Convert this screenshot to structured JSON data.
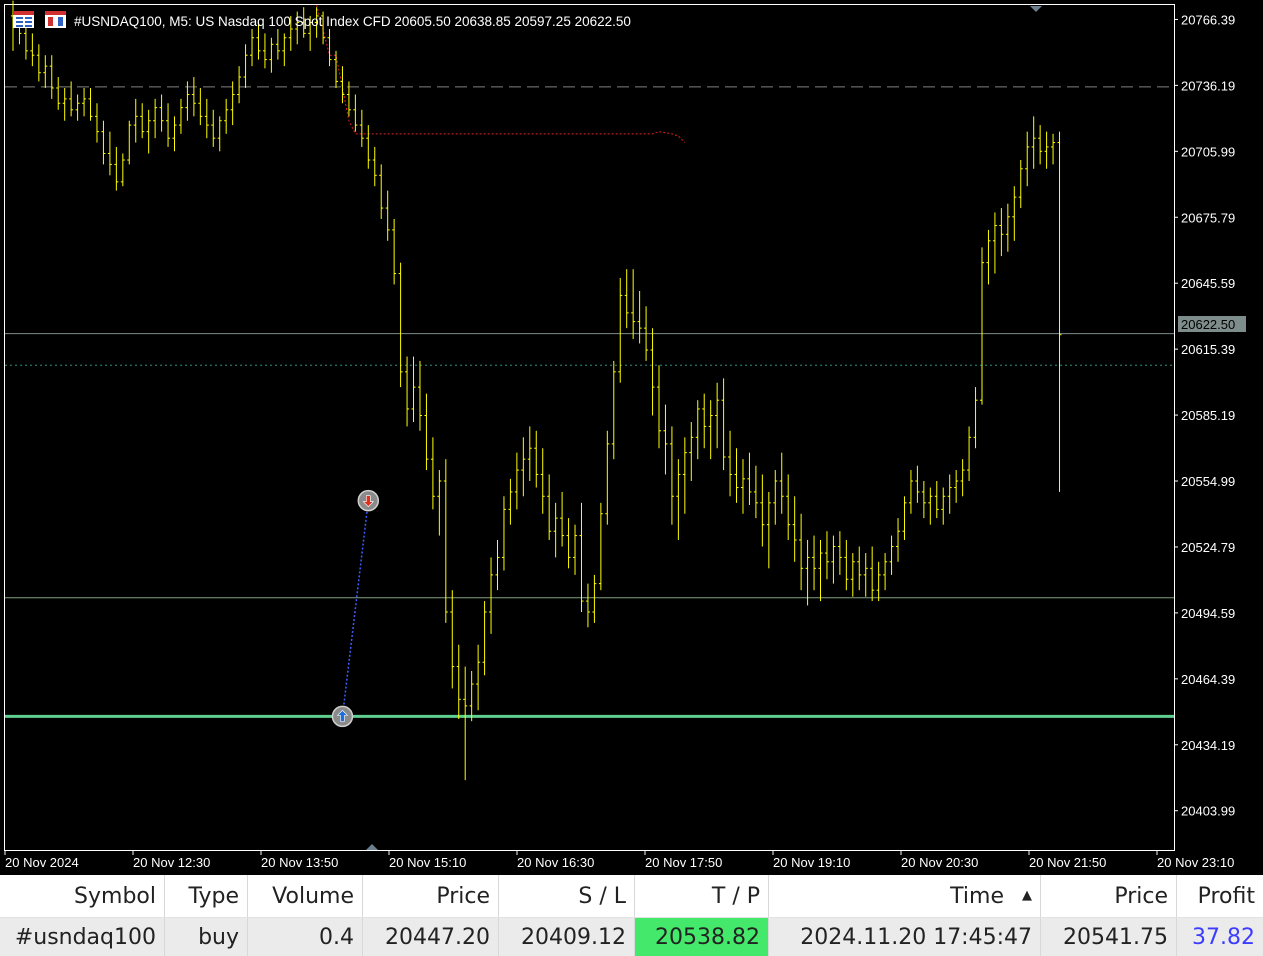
{
  "header": {
    "title": "#USNDAQ100, M5:  US Nasdaq 100 Spot Index CFD  20605.50 20638.85 20597.25 20622.50",
    "icons": [
      "chart-menu-icon",
      "one-click-trading-icon"
    ]
  },
  "price_axis": {
    "labels": [
      "20766.39",
      "20736.19",
      "20705.99",
      "20675.79",
      "20645.59",
      "20615.39",
      "20585.19",
      "20554.99",
      "20524.79",
      "20494.59",
      "20464.39",
      "20434.19",
      "20403.99"
    ],
    "current_price_label": "20622.50"
  },
  "time_axis": {
    "labels": [
      "20 Nov 2024",
      "20 Nov 12:30",
      "20 Nov 13:50",
      "20 Nov 15:10",
      "20 Nov 16:30",
      "20 Nov 17:50",
      "20 Nov 19:10",
      "20 Nov 20:30",
      "20 Nov 21:50",
      "20 Nov 23:10"
    ]
  },
  "chart_data": {
    "type": "ohlc",
    "symbol": "#USNDAQ100",
    "timeframe": "M5",
    "ylim": [
      20386,
      20773
    ],
    "bar_color": "#ffff00",
    "current_bar": {
      "open": 20605.5,
      "high": 20638.85,
      "low": 20597.25,
      "close": 20622.5
    },
    "bars": [
      [
        20768,
        20775,
        20752,
        20764
      ],
      [
        20764,
        20768,
        20755,
        20760
      ],
      [
        20760,
        20764,
        20748,
        20752
      ],
      [
        20752,
        20760,
        20745,
        20750
      ],
      [
        20750,
        20755,
        20738,
        20742
      ],
      [
        20742,
        20750,
        20735,
        20745
      ],
      [
        20745,
        20750,
        20730,
        20735
      ],
      [
        20735,
        20740,
        20725,
        20728
      ],
      [
        20728,
        20735,
        20720,
        20730
      ],
      [
        20730,
        20738,
        20722,
        20725
      ],
      [
        20725,
        20732,
        20720,
        20728
      ],
      [
        20728,
        20735,
        20722,
        20730
      ],
      [
        20730,
        20735,
        20720,
        20722
      ],
      [
        20722,
        20728,
        20710,
        20715
      ],
      [
        20715,
        20720,
        20700,
        20705
      ],
      [
        20705,
        20715,
        20695,
        20700
      ],
      [
        20700,
        20708,
        20688,
        20692
      ],
      [
        20692,
        20705,
        20690,
        20702
      ],
      [
        20702,
        20720,
        20700,
        20718
      ],
      [
        20718,
        20730,
        20710,
        20722
      ],
      [
        20722,
        20728,
        20712,
        20715
      ],
      [
        20715,
        20725,
        20705,
        20720
      ],
      [
        20720,
        20730,
        20712,
        20726
      ],
      [
        20726,
        20732,
        20715,
        20720
      ],
      [
        20720,
        20728,
        20708,
        20712
      ],
      [
        20712,
        20722,
        20706,
        20718
      ],
      [
        20718,
        20730,
        20714,
        20726
      ],
      [
        20726,
        20738,
        20720,
        20732
      ],
      [
        20732,
        20740,
        20722,
        20728
      ],
      [
        20728,
        20735,
        20718,
        20722
      ],
      [
        20722,
        20730,
        20712,
        20718
      ],
      [
        20718,
        20725,
        20708,
        20712
      ],
      [
        20712,
        20722,
        20706,
        20720
      ],
      [
        20720,
        20730,
        20714,
        20725
      ],
      [
        20725,
        20738,
        20718,
        20732
      ],
      [
        20732,
        20745,
        20728,
        20740
      ],
      [
        20740,
        20755,
        20735,
        20750
      ],
      [
        20750,
        20762,
        20745,
        20758
      ],
      [
        20758,
        20765,
        20748,
        20752
      ],
      [
        20752,
        20760,
        20744,
        20748
      ],
      [
        20748,
        20758,
        20742,
        20755
      ],
      [
        20755,
        20762,
        20748,
        20752
      ],
      [
        20752,
        20760,
        20745,
        20758
      ],
      [
        20758,
        20768,
        20752,
        20762
      ],
      [
        20762,
        20770,
        20755,
        20765
      ],
      [
        20765,
        20772,
        20758,
        20760
      ],
      [
        20760,
        20768,
        20752,
        20765
      ],
      [
        20765,
        20772,
        20758,
        20768
      ],
      [
        20768,
        20770,
        20755,
        20758
      ],
      [
        20758,
        20762,
        20745,
        20748
      ],
      [
        20748,
        20752,
        20735,
        20738
      ],
      [
        20738,
        20745,
        20728,
        20732
      ],
      [
        20732,
        20738,
        20722,
        20725
      ],
      [
        20725,
        20732,
        20715,
        20718
      ],
      [
        20718,
        20725,
        20708,
        20712
      ],
      [
        20712,
        20718,
        20698,
        20702
      ],
      [
        20702,
        20708,
        20690,
        20695
      ],
      [
        20695,
        20700,
        20675,
        20680
      ],
      [
        20680,
        20688,
        20665,
        20670
      ],
      [
        20670,
        20675,
        20645,
        20650
      ],
      [
        20650,
        20655,
        20598,
        20605
      ],
      [
        20605,
        20612,
        20580,
        20588
      ],
      [
        20588,
        20612,
        20582,
        20598
      ],
      [
        20598,
        20610,
        20578,
        20585
      ],
      [
        20585,
        20595,
        20560,
        20565
      ],
      [
        20565,
        20575,
        20542,
        20548
      ],
      [
        20548,
        20560,
        20530,
        20555
      ],
      [
        20555,
        20565,
        20490,
        20495
      ],
      [
        20495,
        20505,
        20460,
        20470
      ],
      [
        20470,
        20480,
        20446,
        20455
      ],
      [
        20455,
        20470,
        20418,
        20452
      ],
      [
        20452,
        20468,
        20445,
        20462
      ],
      [
        20462,
        20480,
        20450,
        20472
      ],
      [
        20472,
        20500,
        20466,
        20495
      ],
      [
        20495,
        20520,
        20485,
        20512
      ],
      [
        20512,
        20528,
        20505,
        20520
      ],
      [
        20520,
        20548,
        20514,
        20542
      ],
      [
        20542,
        20556,
        20535,
        20550
      ],
      [
        20550,
        20568,
        20542,
        20560
      ],
      [
        20560,
        20575,
        20548,
        20565
      ],
      [
        20565,
        20580,
        20555,
        20570
      ],
      [
        20570,
        20578,
        20552,
        20558
      ],
      [
        20558,
        20570,
        20540,
        20548
      ],
      [
        20548,
        20558,
        20528,
        20532
      ],
      [
        20532,
        20545,
        20520,
        20538
      ],
      [
        20538,
        20550,
        20525,
        20530
      ],
      [
        20530,
        20538,
        20515,
        20520
      ],
      [
        20520,
        20535,
        20512,
        20530
      ],
      [
        20530,
        20545,
        20495,
        20500
      ],
      [
        20500,
        20508,
        20488,
        20495
      ],
      [
        20495,
        20512,
        20490,
        20508
      ],
      [
        20508,
        20545,
        20505,
        20540
      ],
      [
        20540,
        20578,
        20535,
        20572
      ],
      [
        20572,
        20610,
        20565,
        20605
      ],
      [
        20605,
        20648,
        20600,
        20640
      ],
      [
        20640,
        20652,
        20625,
        20632
      ],
      [
        20632,
        20652,
        20620,
        20628
      ],
      [
        20628,
        20642,
        20618,
        20625
      ],
      [
        20625,
        20635,
        20610,
        20615
      ],
      [
        20615,
        20625,
        20585,
        20598
      ],
      [
        20598,
        20608,
        20570,
        20578
      ],
      [
        20578,
        20590,
        20558,
        20572
      ],
      [
        20572,
        20580,
        20535,
        20548
      ],
      [
        20548,
        20565,
        20528,
        20558
      ],
      [
        20558,
        20575,
        20540,
        20568
      ],
      [
        20568,
        20582,
        20555,
        20575
      ],
      [
        20575,
        20592,
        20565,
        20588
      ],
      [
        20588,
        20595,
        20570,
        20580
      ],
      [
        20580,
        20592,
        20565,
        20585
      ],
      [
        20585,
        20600,
        20570,
        20592
      ],
      [
        20592,
        20602,
        20560,
        20566
      ],
      [
        20566,
        20578,
        20548,
        20558
      ],
      [
        20558,
        20570,
        20545,
        20552
      ],
      [
        20552,
        20565,
        20540,
        20556
      ],
      [
        20556,
        20568,
        20544,
        20550
      ],
      [
        20550,
        20562,
        20538,
        20545
      ],
      [
        20545,
        20558,
        20525,
        20535
      ],
      [
        20535,
        20550,
        20515,
        20545
      ],
      [
        20545,
        20560,
        20535,
        20555
      ],
      [
        20555,
        20568,
        20540,
        20548
      ],
      [
        20548,
        20558,
        20528,
        20535
      ],
      [
        20535,
        20548,
        20518,
        20528
      ],
      [
        20528,
        20540,
        20505,
        20515
      ],
      [
        20515,
        20528,
        20498,
        20520
      ],
      [
        20520,
        20530,
        20505,
        20515
      ],
      [
        20515,
        20528,
        20500,
        20522
      ],
      [
        20522,
        20532,
        20510,
        20518
      ],
      [
        20518,
        20530,
        20508,
        20525
      ],
      [
        20525,
        20532,
        20512,
        20520
      ],
      [
        20520,
        20528,
        20505,
        20510
      ],
      [
        20510,
        20522,
        20502,
        20518
      ],
      [
        20518,
        20525,
        20505,
        20512
      ],
      [
        20512,
        20522,
        20502,
        20515
      ],
      [
        20515,
        20525,
        20500,
        20505
      ],
      [
        20505,
        20518,
        20500,
        20512
      ],
      [
        20512,
        20522,
        20505,
        20518
      ],
      [
        20518,
        20530,
        20512,
        20525
      ],
      [
        20525,
        20538,
        20518,
        20532
      ],
      [
        20532,
        20548,
        20528,
        20545
      ],
      [
        20545,
        20560,
        20540,
        20555
      ],
      [
        20555,
        20562,
        20545,
        20550
      ],
      [
        20550,
        20555,
        20538,
        20545
      ],
      [
        20545,
        20552,
        20535,
        20548
      ],
      [
        20548,
        20555,
        20538,
        20542
      ],
      [
        20542,
        20552,
        20535,
        20548
      ],
      [
        20548,
        20558,
        20540,
        20552
      ],
      [
        20552,
        20560,
        20545,
        20555
      ],
      [
        20555,
        20565,
        20548,
        20560
      ],
      [
        20560,
        20580,
        20555,
        20575
      ],
      [
        20575,
        20598,
        20570,
        20592
      ],
      [
        20592,
        20662,
        20590,
        20655
      ],
      [
        20655,
        20670,
        20645,
        20665
      ],
      [
        20665,
        20678,
        20650,
        20672
      ],
      [
        20672,
        20680,
        20658,
        20668
      ],
      [
        20668,
        20682,
        20660,
        20676
      ],
      [
        20676,
        20690,
        20665,
        20685
      ],
      [
        20685,
        20702,
        20680,
        20698
      ],
      [
        20698,
        20715,
        20690,
        20708
      ],
      [
        20708,
        20722,
        20698,
        20712
      ],
      [
        20712,
        20718,
        20700,
        20706
      ],
      [
        20706,
        20715,
        20698,
        20708
      ],
      [
        20708,
        20714,
        20700,
        20710
      ],
      [
        20710,
        20715,
        20550,
        20622
      ]
    ],
    "horizontal_lines": [
      {
        "price": 20735.5,
        "style": "dashed",
        "color": "#7f7f7f"
      },
      {
        "price": 20622.5,
        "style": "solid",
        "color": "#7f8c8c"
      },
      {
        "price": 20608.0,
        "style": "dotted",
        "color": "#2f8f7f"
      },
      {
        "price": 20501.5,
        "style": "solid",
        "color": "#7fa07f"
      },
      {
        "price": 20447.2,
        "style": "solid",
        "color": "#5fcf8f"
      }
    ],
    "red_indicator": [
      [
        47,
        20773
      ],
      [
        49,
        20750
      ],
      [
        50,
        20750
      ],
      [
        52,
        20720
      ],
      [
        53,
        20714
      ],
      [
        99,
        20714
      ],
      [
        100,
        20715
      ],
      [
        102,
        20714
      ],
      [
        103,
        20713
      ],
      [
        104,
        20710
      ]
    ],
    "trade_markers": [
      {
        "type": "buy-arrow",
        "bar": 51,
        "price": 20447.2
      },
      {
        "type": "sell-arrow",
        "bar": 55,
        "price": 20546.0
      }
    ]
  },
  "terminal": {
    "columns": [
      "Symbol",
      "Type",
      "Volume",
      "Price",
      "S / L",
      "T / P",
      "Time",
      "Price",
      "Profit"
    ],
    "sort_indicator": "up-arrow",
    "rows": [
      {
        "symbol": "#usndaq100",
        "type": "buy",
        "volume": "0.4",
        "open_price": "20447.20",
        "sl": "20409.12",
        "tp": "20538.82",
        "time": "2024.11.20 17:45:47",
        "current_price": "20541.75",
        "profit": "37.82"
      }
    ]
  },
  "colors": {
    "chart_background": "#000000",
    "bars": "#ffff00",
    "axis_text": "#ffffff",
    "grid": "#ffffff",
    "tp_highlight": "#44e86a",
    "profit_text": "#3c3cff"
  }
}
